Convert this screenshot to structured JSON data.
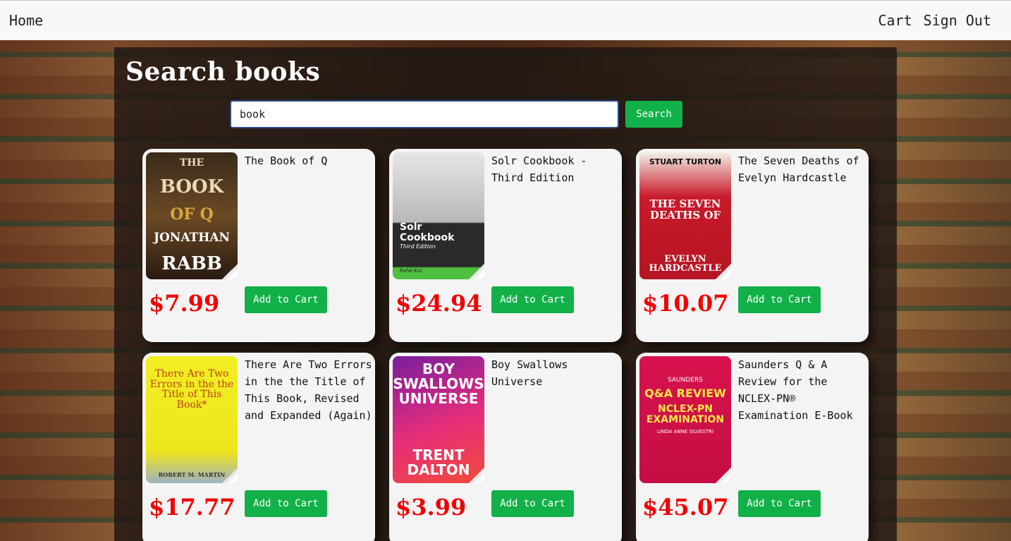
{
  "nav": {
    "home": "Home",
    "cart": "Cart",
    "sign_out": "Sign Out"
  },
  "page": {
    "title": "Search books"
  },
  "search": {
    "value": "book",
    "button": "Search"
  },
  "books": [
    {
      "title": "The Book of Q",
      "price": "$7.99",
      "add_label": "Add to Cart",
      "cover_text": [
        "THE",
        "BOOK",
        "OF Q",
        "JONATHAN",
        "RABB"
      ]
    },
    {
      "title": "Solr Cookbook - Third Edition",
      "price": "$24.94",
      "add_label": "Add to Cart",
      "cover_text": [
        "Solr Cookbook",
        "Third Edition",
        "Rafał Kuć"
      ]
    },
    {
      "title": "The Seven Deaths of Evelyn Hardcastle",
      "price": "$10.07",
      "add_label": "Add to Cart",
      "cover_text": [
        "STUART TURTON",
        "THE SEVEN DEATHS OF",
        "EVELYN HARDCASTLE"
      ]
    },
    {
      "title": "There Are Two Errors in the the Title of This Book, Revised and Expanded (Again)",
      "price": "$17.77",
      "add_label": "Add to Cart",
      "cover_text": [
        "There Are Two Errors in the the Title of This Book*",
        "ROBERT M. MARTIN"
      ]
    },
    {
      "title": "Boy Swallows Universe",
      "price": "$3.99",
      "add_label": "Add to Cart",
      "cover_text": [
        "BOY SWALLOWS UNIVERSE",
        "TRENT DALTON"
      ]
    },
    {
      "title": "Saunders Q & A Review for the NCLEX-PN® Examination E-Book",
      "price": "$45.07",
      "add_label": "Add to Cart",
      "cover_text": [
        "SAUNDERS",
        "Q&A REVIEW",
        "NCLEX-PN EXAMINATION",
        "LINDA ANNE SILVESTRI"
      ]
    }
  ]
}
